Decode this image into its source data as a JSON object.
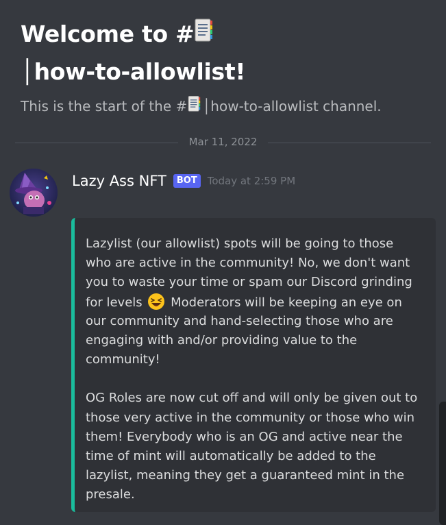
{
  "channel": {
    "welcome_prefix": "Welcome to #",
    "welcome_name": "│how-to-allowlist!",
    "start_prefix": "This is the start of the #",
    "start_suffix": "│how-to-allowlist channel.",
    "channel_icon": "memo-icon"
  },
  "divider": {
    "date": "Mar 11, 2022"
  },
  "message": {
    "author": "Lazy Ass NFT",
    "badge": "BOT",
    "timestamp": "Today at 2:59 PM",
    "avatar_icon": "wizard-avatar",
    "embed_color": "#1abc9c",
    "paragraph1": [
      "Lazylist (our allowlist) spots will be going to those",
      "who are active in the community! No, we don't want",
      "you to waste your time or spam our Discord grinding",
      "Moderators will be keeping an eye on",
      "our community and hand-selecting those who are",
      "engaging with and/or providing value to the",
      "community!"
    ],
    "paragraph1_line4_prefix": "for levels",
    "paragraph1_emoji": "laughing-emoji",
    "paragraph2": [
      "OG Roles are now cut off and will only be given out to",
      "those very active in the community or those who win",
      "them! Everybody who is an OG and active near the",
      "time of mint will automatically be added to the",
      "lazylist, meaning they get a guaranteed mint in the",
      "presale."
    ]
  }
}
